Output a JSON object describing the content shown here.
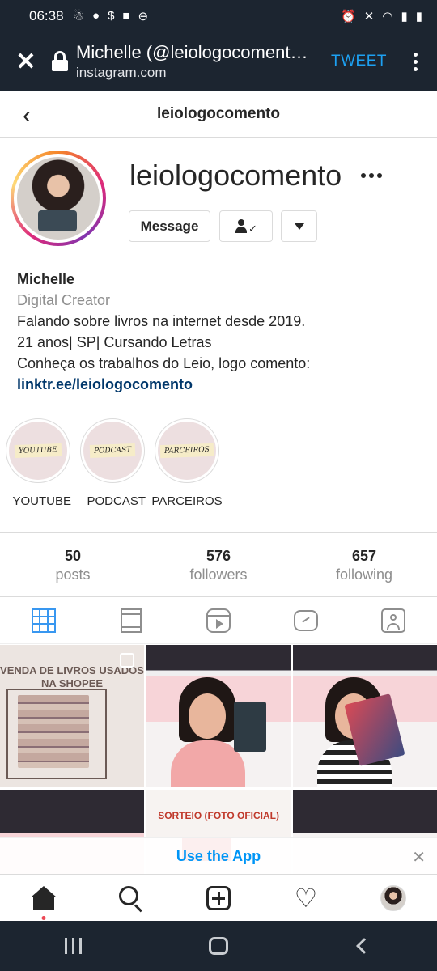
{
  "status_bar": {
    "time": "06:38"
  },
  "browser": {
    "page_title": "Michelle (@leiologocomento) • Instagram photos and videos",
    "url": "instagram.com",
    "tweet_label": "TWEET"
  },
  "header": {
    "username": "leiologocomento"
  },
  "profile": {
    "username": "leiologocomento",
    "message_label": "Message",
    "full_name": "Michelle",
    "category": "Digital Creator",
    "bio_lines": [
      "Falando sobre livros na internet desde 2019.",
      "21 anos| SP| Cursando Letras",
      "Conheça os trabalhos do Leio, logo comento:"
    ],
    "link": "linktr.ee/leiologocomento"
  },
  "highlights": [
    {
      "label": "YOUTUBE",
      "cover_text": "YOUTUBE"
    },
    {
      "label": "PODCAST",
      "cover_text": "PODCAST"
    },
    {
      "label": "PARCEIROS",
      "cover_text": "PARCEIROS"
    }
  ],
  "stats": [
    {
      "number": "50",
      "label": "posts"
    },
    {
      "number": "576",
      "label": "followers"
    },
    {
      "number": "657",
      "label": "following"
    }
  ],
  "tabs": [
    "grid-icon",
    "feed-icon",
    "reels-icon",
    "igtv-icon",
    "tagged-icon"
  ],
  "posts": {
    "post1_text": "VENDA DE LIVROS USADOS NA SHOPEE",
    "post5_text": "SORTEIO (FOTO OFICIAL)"
  },
  "use_app": {
    "label": "Use the App"
  },
  "colors": {
    "accent": "#0095f6",
    "tweet": "#1da1f2",
    "system_bar": "#1c2530"
  }
}
